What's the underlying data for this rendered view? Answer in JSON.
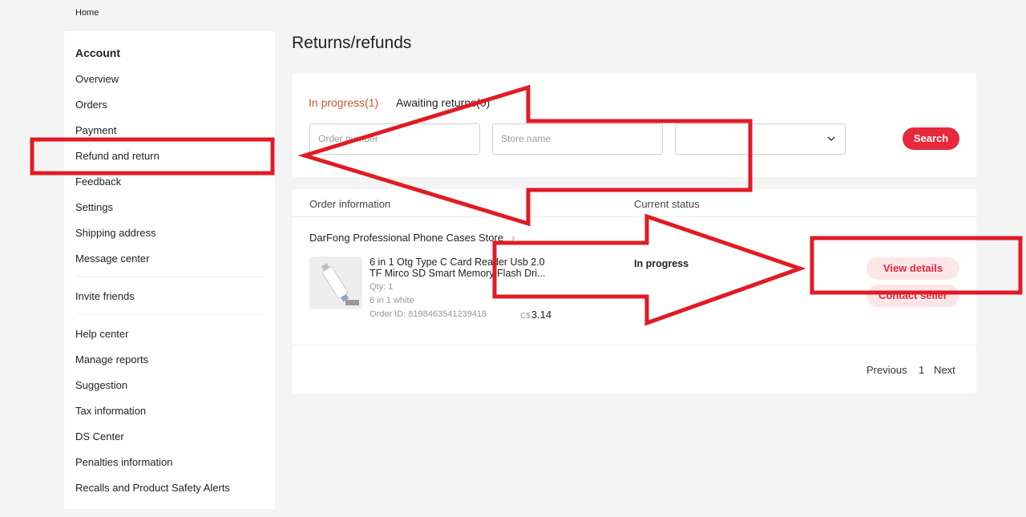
{
  "breadcrumb": "Home",
  "sidebar": {
    "heading": "Account",
    "items": [
      "Overview",
      "Orders",
      "Payment",
      "Refund and return",
      "Feedback",
      "Settings",
      "Shipping address",
      "Message center",
      "Invite friends",
      "Help center",
      "Manage reports",
      "Suggestion",
      "Tax information",
      "DS Center",
      "Penalties information",
      "Recalls and Product Safety Alerts"
    ]
  },
  "page_title": "Returns/refunds",
  "tabs": {
    "in_progress": "In progress(1)",
    "awaiting": "Awaiting returns(0)"
  },
  "filters": {
    "order_number_placeholder": "Order number",
    "store_name_placeholder": "Store name",
    "select_value": "",
    "search_label": "Search"
  },
  "table": {
    "col_order": "Order information",
    "col_status": "Current status",
    "store": "DarFong Professional Phone Cases Store",
    "product_name": "6 in 1 Otg Type C Card Reader Usb 2.0 TF Mirco SD Smart Memory Flash Dri...",
    "qty": "Qty: 1",
    "variant": "6 in 1 white",
    "order_id": "Order ID: 8198463541239418",
    "currency": "C$",
    "price": "3.14",
    "status": "In progress",
    "view_details": "View details",
    "contact_seller": "Contact seller"
  },
  "pager": {
    "previous": "Previous",
    "page": "1",
    "next": "Next"
  },
  "colors": {
    "accent": "#e8283c",
    "tab_active": "#c8553d",
    "annotation": "#e01b24"
  }
}
